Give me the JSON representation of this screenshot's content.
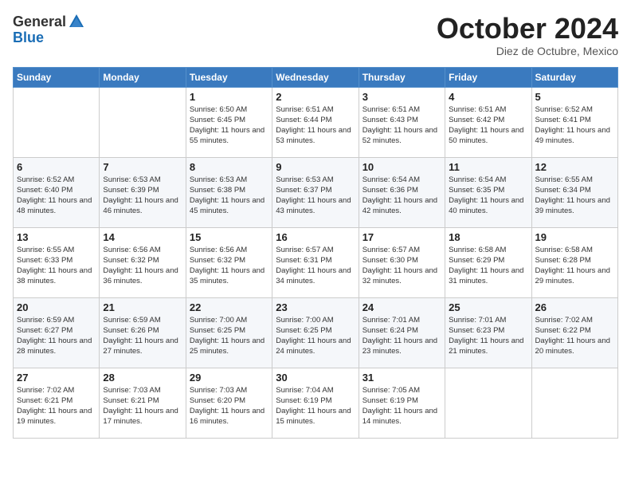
{
  "logo": {
    "general": "General",
    "blue": "Blue"
  },
  "header": {
    "month": "October 2024",
    "location": "Diez de Octubre, Mexico"
  },
  "weekdays": [
    "Sunday",
    "Monday",
    "Tuesday",
    "Wednesday",
    "Thursday",
    "Friday",
    "Saturday"
  ],
  "weeks": [
    [
      {
        "day": "",
        "info": ""
      },
      {
        "day": "",
        "info": ""
      },
      {
        "day": "1",
        "info": "Sunrise: 6:50 AM\nSunset: 6:45 PM\nDaylight: 11 hours and 55 minutes."
      },
      {
        "day": "2",
        "info": "Sunrise: 6:51 AM\nSunset: 6:44 PM\nDaylight: 11 hours and 53 minutes."
      },
      {
        "day": "3",
        "info": "Sunrise: 6:51 AM\nSunset: 6:43 PM\nDaylight: 11 hours and 52 minutes."
      },
      {
        "day": "4",
        "info": "Sunrise: 6:51 AM\nSunset: 6:42 PM\nDaylight: 11 hours and 50 minutes."
      },
      {
        "day": "5",
        "info": "Sunrise: 6:52 AM\nSunset: 6:41 PM\nDaylight: 11 hours and 49 minutes."
      }
    ],
    [
      {
        "day": "6",
        "info": "Sunrise: 6:52 AM\nSunset: 6:40 PM\nDaylight: 11 hours and 48 minutes."
      },
      {
        "day": "7",
        "info": "Sunrise: 6:53 AM\nSunset: 6:39 PM\nDaylight: 11 hours and 46 minutes."
      },
      {
        "day": "8",
        "info": "Sunrise: 6:53 AM\nSunset: 6:38 PM\nDaylight: 11 hours and 45 minutes."
      },
      {
        "day": "9",
        "info": "Sunrise: 6:53 AM\nSunset: 6:37 PM\nDaylight: 11 hours and 43 minutes."
      },
      {
        "day": "10",
        "info": "Sunrise: 6:54 AM\nSunset: 6:36 PM\nDaylight: 11 hours and 42 minutes."
      },
      {
        "day": "11",
        "info": "Sunrise: 6:54 AM\nSunset: 6:35 PM\nDaylight: 11 hours and 40 minutes."
      },
      {
        "day": "12",
        "info": "Sunrise: 6:55 AM\nSunset: 6:34 PM\nDaylight: 11 hours and 39 minutes."
      }
    ],
    [
      {
        "day": "13",
        "info": "Sunrise: 6:55 AM\nSunset: 6:33 PM\nDaylight: 11 hours and 38 minutes."
      },
      {
        "day": "14",
        "info": "Sunrise: 6:56 AM\nSunset: 6:32 PM\nDaylight: 11 hours and 36 minutes."
      },
      {
        "day": "15",
        "info": "Sunrise: 6:56 AM\nSunset: 6:32 PM\nDaylight: 11 hours and 35 minutes."
      },
      {
        "day": "16",
        "info": "Sunrise: 6:57 AM\nSunset: 6:31 PM\nDaylight: 11 hours and 34 minutes."
      },
      {
        "day": "17",
        "info": "Sunrise: 6:57 AM\nSunset: 6:30 PM\nDaylight: 11 hours and 32 minutes."
      },
      {
        "day": "18",
        "info": "Sunrise: 6:58 AM\nSunset: 6:29 PM\nDaylight: 11 hours and 31 minutes."
      },
      {
        "day": "19",
        "info": "Sunrise: 6:58 AM\nSunset: 6:28 PM\nDaylight: 11 hours and 29 minutes."
      }
    ],
    [
      {
        "day": "20",
        "info": "Sunrise: 6:59 AM\nSunset: 6:27 PM\nDaylight: 11 hours and 28 minutes."
      },
      {
        "day": "21",
        "info": "Sunrise: 6:59 AM\nSunset: 6:26 PM\nDaylight: 11 hours and 27 minutes."
      },
      {
        "day": "22",
        "info": "Sunrise: 7:00 AM\nSunset: 6:25 PM\nDaylight: 11 hours and 25 minutes."
      },
      {
        "day": "23",
        "info": "Sunrise: 7:00 AM\nSunset: 6:25 PM\nDaylight: 11 hours and 24 minutes."
      },
      {
        "day": "24",
        "info": "Sunrise: 7:01 AM\nSunset: 6:24 PM\nDaylight: 11 hours and 23 minutes."
      },
      {
        "day": "25",
        "info": "Sunrise: 7:01 AM\nSunset: 6:23 PM\nDaylight: 11 hours and 21 minutes."
      },
      {
        "day": "26",
        "info": "Sunrise: 7:02 AM\nSunset: 6:22 PM\nDaylight: 11 hours and 20 minutes."
      }
    ],
    [
      {
        "day": "27",
        "info": "Sunrise: 7:02 AM\nSunset: 6:21 PM\nDaylight: 11 hours and 19 minutes."
      },
      {
        "day": "28",
        "info": "Sunrise: 7:03 AM\nSunset: 6:21 PM\nDaylight: 11 hours and 17 minutes."
      },
      {
        "day": "29",
        "info": "Sunrise: 7:03 AM\nSunset: 6:20 PM\nDaylight: 11 hours and 16 minutes."
      },
      {
        "day": "30",
        "info": "Sunrise: 7:04 AM\nSunset: 6:19 PM\nDaylight: 11 hours and 15 minutes."
      },
      {
        "day": "31",
        "info": "Sunrise: 7:05 AM\nSunset: 6:19 PM\nDaylight: 11 hours and 14 minutes."
      },
      {
        "day": "",
        "info": ""
      },
      {
        "day": "",
        "info": ""
      }
    ]
  ]
}
